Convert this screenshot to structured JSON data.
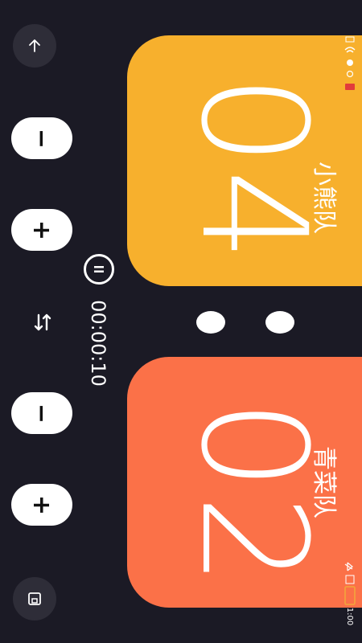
{
  "colors": {
    "background": "#1b1a25",
    "team_a_card": "#f7b02d",
    "team_b_card": "#fb7148",
    "button": "#ffffff",
    "circle_button": "#2e2d38"
  },
  "team_a": {
    "name": "小熊队",
    "score": "04"
  },
  "team_b": {
    "name": "青菜队",
    "score": "02"
  },
  "controls": {
    "minus_label": "−",
    "plus_label": "+",
    "swap_icon": "swap-arrows-icon",
    "top_icon": "arrow-up-icon",
    "bottom_icon": "save-icon"
  },
  "timer": {
    "value": "00:00:10",
    "pause_icon": "pause-icon"
  },
  "status_bar": {
    "time": "1:00"
  }
}
